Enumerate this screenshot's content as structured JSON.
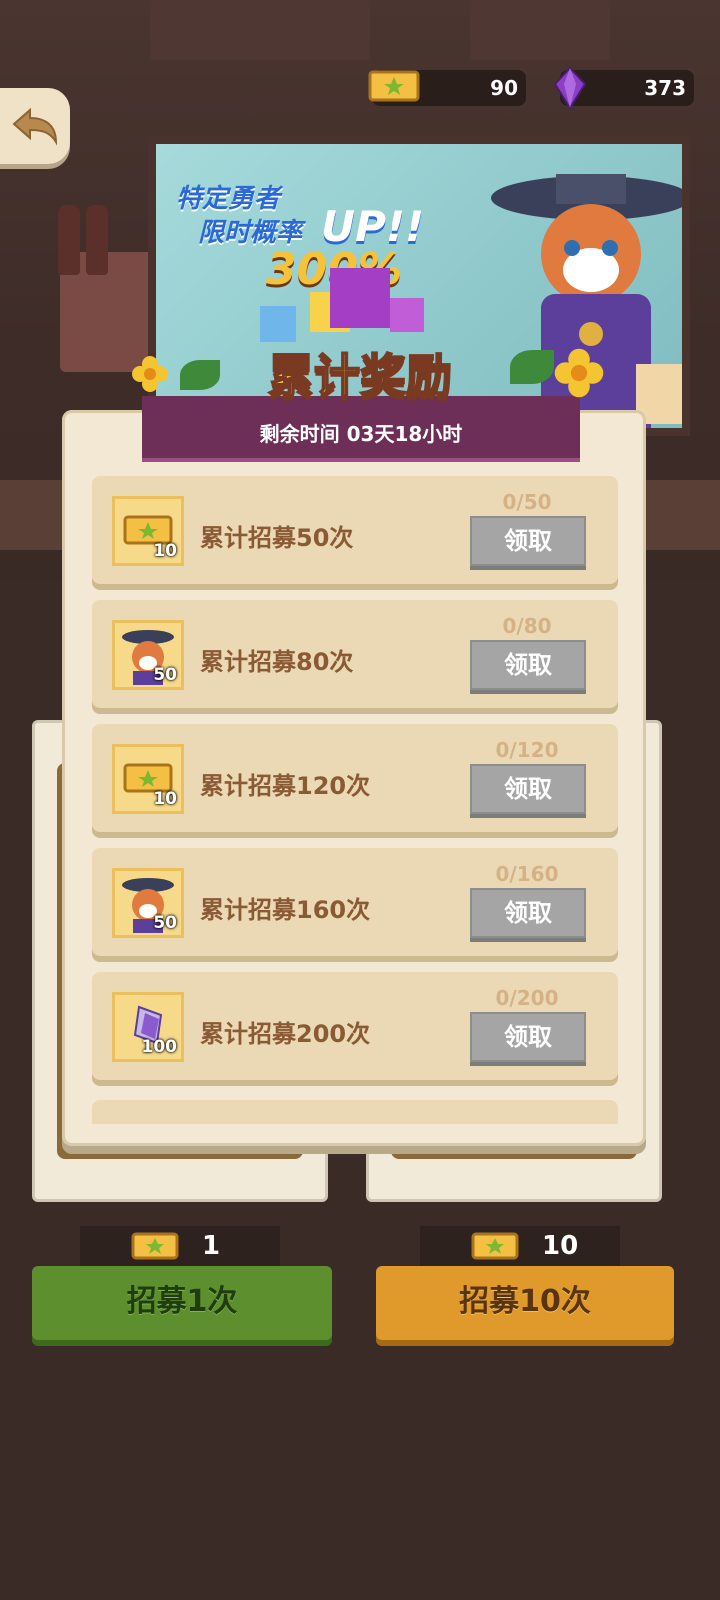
{
  "currency": {
    "tickets": "90",
    "gems": "373"
  },
  "banner": {
    "line1": "特定勇者",
    "line2": "限时概率",
    "up": "UP!!",
    "percent": "300%"
  },
  "modal": {
    "title": "累计奖励",
    "remaining_time": "剩余时间 03天18小时",
    "claim_label": "领取",
    "rows": [
      {
        "label": "累计招募50次",
        "progress": "0/50",
        "reward_type": "ticket",
        "qty": "10"
      },
      {
        "label": "累计招募80次",
        "progress": "0/80",
        "reward_type": "hero-shard",
        "qty": "50"
      },
      {
        "label": "累计招募120次",
        "progress": "0/120",
        "reward_type": "ticket",
        "qty": "10"
      },
      {
        "label": "累计招募160次",
        "progress": "0/160",
        "reward_type": "hero-shard",
        "qty": "50"
      },
      {
        "label": "累计招募200次",
        "progress": "0/200",
        "reward_type": "gem",
        "qty": "100"
      }
    ]
  },
  "recruit": {
    "single": {
      "cost": "1",
      "label": "招募1次"
    },
    "ten": {
      "cost": "10",
      "label": "招募10次"
    }
  },
  "colors": {
    "modal_bg": "#f2e8d3",
    "row_bg": "#ead9b4",
    "claim_disabled": "#a5a5a5",
    "header_purple": "#6d2f57",
    "title_yellow": "#ffe35a",
    "recruit_green": "#5d8f2f",
    "recruit_orange": "#e09a2c"
  }
}
